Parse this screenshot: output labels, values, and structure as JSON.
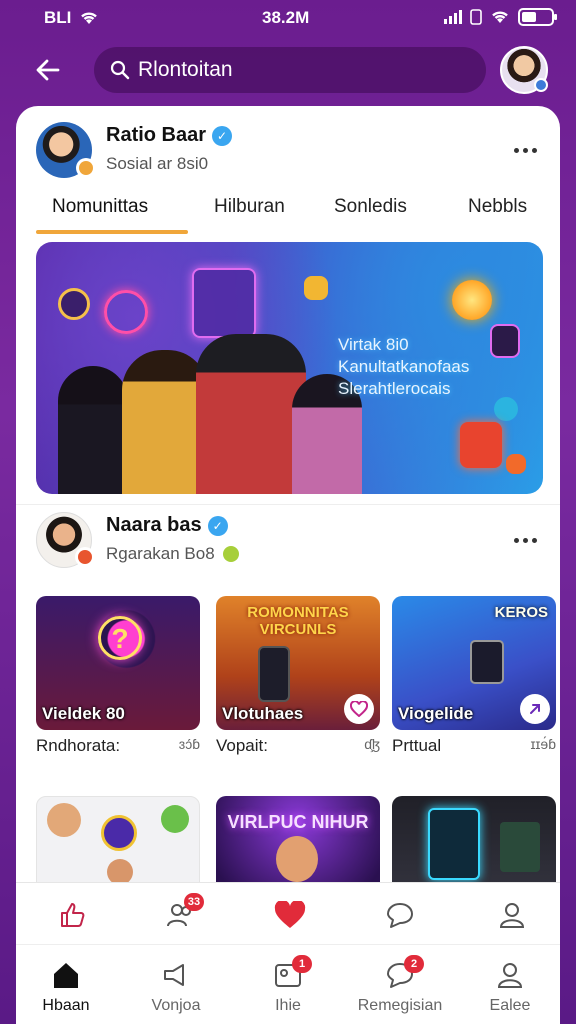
{
  "status_bar": {
    "left_text": "BLI",
    "time": "38.2M"
  },
  "search": {
    "text": "Rlontoitan"
  },
  "post1": {
    "name": "Ratio Baar",
    "subtitle": "Sosial ar 8si0"
  },
  "tabs": [
    {
      "label": "Nomunittas",
      "active": true
    },
    {
      "label": "Hilburan",
      "active": false
    },
    {
      "label": "Sonledis",
      "active": false
    },
    {
      "label": "Nebbls",
      "active": false
    }
  ],
  "hero": {
    "line1": "Virtak 8i0",
    "line2": "Kanultatkanofaas",
    "line3": "Slerahtlerocais"
  },
  "post2": {
    "name": "Naara bas",
    "subtitle": "Rgarakan Bo8"
  },
  "grid": [
    {
      "thumb_label": "Vieldek 80",
      "caption": "Rndhorata:",
      "meta": "ɜɔ́ɓ"
    },
    {
      "thumb_top": "ROMONNITAS VIRCUNLS",
      "thumb_label": "Vlotuhaes",
      "caption": "Vopait:",
      "meta": "ɗ̧ɮ"
    },
    {
      "thumb_title": "KEROS",
      "thumb_label": "Viogelide",
      "caption": "Prttual",
      "meta": "ɪɪɘ́ɓ"
    },
    {
      "thumb_label": ""
    },
    {
      "thumb_top": "VIRLPUC NIHUR",
      "thumb_label": ""
    },
    {
      "thumb_label": ""
    }
  ],
  "actions": {
    "badge_people": "33"
  },
  "nav": [
    {
      "label": "Hbaan",
      "icon": "home-icon",
      "active": true
    },
    {
      "label": "Vonjoa",
      "icon": "megaphone-icon",
      "active": false
    },
    {
      "label": "Ihie",
      "icon": "image-icon",
      "active": false,
      "badge": "1"
    },
    {
      "label": "Remegisian",
      "icon": "chat-icon",
      "active": false,
      "badge": "2"
    },
    {
      "label": "Ealee",
      "icon": "profile-icon",
      "active": false
    }
  ],
  "colors": {
    "background": "#6b1d8f",
    "accent_tab": "#f0a63a",
    "verified": "#3aa6f0",
    "heart": "#e12b3a"
  }
}
